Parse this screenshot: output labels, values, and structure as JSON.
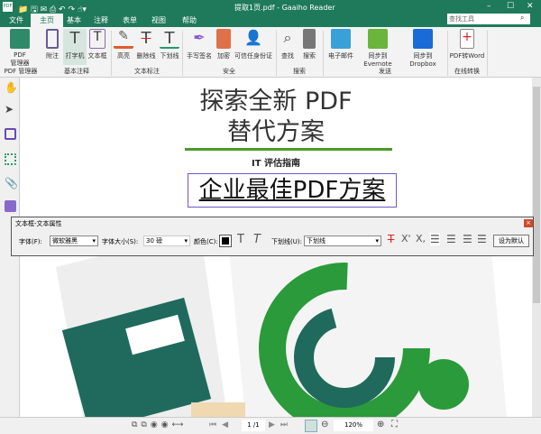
{
  "window": {
    "title": "提取1页.pdf - Gaaiho Reader",
    "minimize": "–",
    "maximize": "☐",
    "close": "✕",
    "app_icon": "PDF"
  },
  "search": {
    "placeholder": "查找工具"
  },
  "tabs": [
    "文件",
    "主页",
    "基本",
    "注释",
    "表单",
    "视图",
    "帮助"
  ],
  "ribbon": {
    "buttons": [
      "PDF\n管理器",
      "附注",
      "打字机",
      "文本框",
      "高亮",
      "删除线",
      "下划线",
      "手写签名",
      "加密",
      "可信任身份证",
      "查找",
      "搜索",
      "电子邮件",
      "同步到Evernote",
      "同步到Dropbox",
      "PDF转Word"
    ],
    "groups": [
      "PDF 管理器",
      "基本注释",
      "文本标注",
      "安全",
      "搜索",
      "发送",
      "在线转换"
    ]
  },
  "document": {
    "title1": "探索全新 PDF",
    "title2": "替代方案",
    "subtitle": "IT 评估指南",
    "headline": "企业最佳PDF方案"
  },
  "dialog": {
    "title": "文本框-文本属性",
    "font_label": "字体(F):",
    "font_value": "微软雅黑",
    "size_label": "字体大小(S):",
    "size_value": "30 磅",
    "color_label": "颜色(C):",
    "underline_label": "下划线(U):",
    "underline_value": "下划线",
    "default_button": "设为默认"
  },
  "status": {
    "page": "1 /1",
    "zoom": "120%"
  },
  "colors": {
    "brand": "#1f7a5c",
    "accent_green": "#4a9a2a"
  }
}
